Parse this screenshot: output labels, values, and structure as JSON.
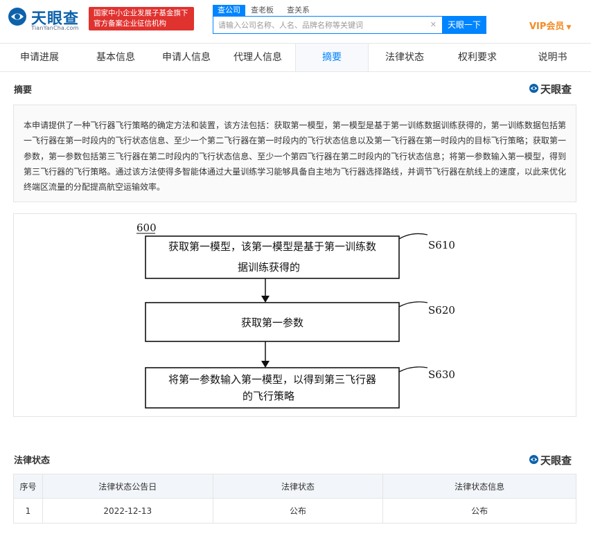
{
  "header": {
    "logo_name": "天眼查",
    "logo_sub": "TianYanCha.com",
    "badge_line1": "国家中小企业发展子基金旗下",
    "badge_line2": "官方备案企业征信机构",
    "search_tabs": [
      "查公司",
      "查老板",
      "查关系"
    ],
    "search_placeholder": "请输入公司名称、人名、品牌名称等关键词",
    "search_button": "天眼一下",
    "vip_label": "VIP会员"
  },
  "nav": {
    "tabs": [
      "申请进展",
      "基本信息",
      "申请人信息",
      "代理人信息",
      "摘要",
      "法律状态",
      "权利要求",
      "说明书"
    ],
    "active_tab": "摘要"
  },
  "abstract_section": {
    "title": "摘要",
    "watermark": "天眼查",
    "text": "本申请提供了一种飞行器飞行策略的确定方法和装置，该方法包括：获取第一模型，第一模型是基于第一训练数据训练获得的，第一训练数据包括第一飞行器在第一时段内的飞行状态信息、至少一个第二飞行器在第一时段内的飞行状态信息以及第一飞行器在第一时段内的目标飞行策略；获取第一参数，第一参数包括第三飞行器在第二时段内的飞行状态信息、至少一个第四飞行器在第二时段内的飞行状态信息；将第一参数输入第一模型，得到第三飞行器的飞行策略。通过该方法使得多智能体通过大量训练学习能够具备自主地为飞行器选择路线，并调节飞行器在航线上的速度，以此来优化终端区流量的分配提高航空运输效率。"
  },
  "figure": {
    "figure_number": "600",
    "steps": [
      {
        "label": "S610",
        "lines": [
          "获取第一模型，该第一模型是基于第一训练数",
          "据训练获得的"
        ]
      },
      {
        "label": "S620",
        "lines": [
          "获取第一参数"
        ]
      },
      {
        "label": "S630",
        "lines": [
          "将第一参数输入第一模型，以得到第三飞行器",
          "的飞行策略"
        ]
      }
    ]
  },
  "legal_section": {
    "title": "法律状态",
    "watermark": "天眼查",
    "columns": [
      "序号",
      "法律状态公告日",
      "法律状态",
      "法律状态信息"
    ],
    "rows": [
      [
        "1",
        "2022-12-13",
        "公布",
        "公布"
      ]
    ]
  },
  "colors": {
    "brand_blue": "#0084ff",
    "logo_blue": "#0d62ab",
    "badge_red": "#e0322f",
    "vip_orange": "#f38b24"
  }
}
